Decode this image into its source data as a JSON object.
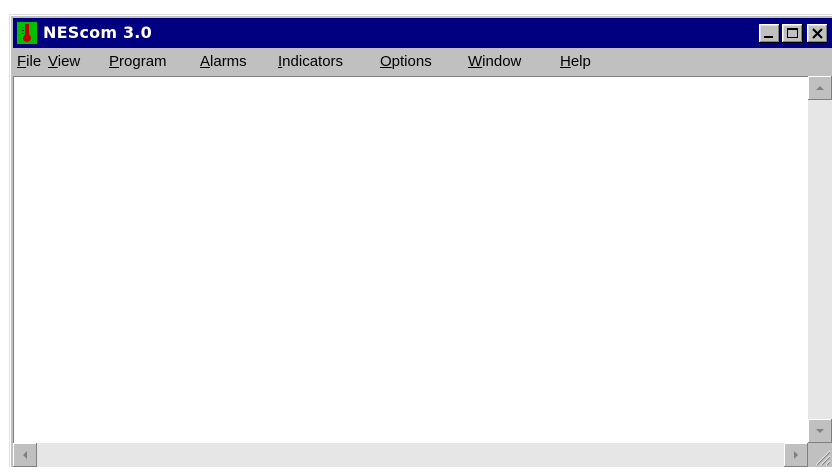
{
  "window": {
    "title": "NEScom 3.0",
    "icon": "thermometer-icon",
    "controls": [
      "minimize-icon",
      "maximize-icon",
      "close-icon"
    ]
  },
  "menu": {
    "items": [
      {
        "mnemonic": "F",
        "rest": "ile"
      },
      {
        "mnemonic": "V",
        "rest": "iew"
      },
      {
        "mnemonic": "P",
        "rest": "rogram"
      },
      {
        "mnemonic": "A",
        "rest": "larms"
      },
      {
        "mnemonic": "I",
        "rest": "ndicators"
      },
      {
        "mnemonic": "O",
        "rest": "ptions"
      },
      {
        "mnemonic": "W",
        "rest": "indow"
      },
      {
        "mnemonic": "H",
        "rest": "elp"
      }
    ]
  },
  "colors": {
    "titlebar": "#000080",
    "title_text": "#ffffff",
    "icon_background": "#00c000",
    "thermometer": "#c00000",
    "chrome": "#c0c0c0",
    "workspace": "#ffffff"
  }
}
